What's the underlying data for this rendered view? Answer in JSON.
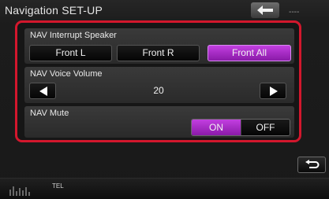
{
  "header": {
    "title": "Navigation SET-UP",
    "top_right_text": "----"
  },
  "panel": {
    "interrupt": {
      "label": "NAV Interrupt Speaker",
      "options": [
        "Front L",
        "Front R",
        "Front All"
      ],
      "selected": "Front All"
    },
    "volume": {
      "label": "NAV Voice Volume",
      "value": "20"
    },
    "mute": {
      "label": "NAV Mute",
      "on_label": "ON",
      "off_label": "OFF",
      "selected": "ON"
    }
  },
  "bottom": {
    "tel_label": "TEL"
  },
  "icons": {
    "top_back": "back-arrow-icon",
    "return": "return-icon",
    "left": "triangle-left-icon",
    "right": "triangle-right-icon",
    "eq": "equalizer-icon"
  },
  "colors": {
    "frame": "#d3172d",
    "selected": "#a42dc4"
  }
}
